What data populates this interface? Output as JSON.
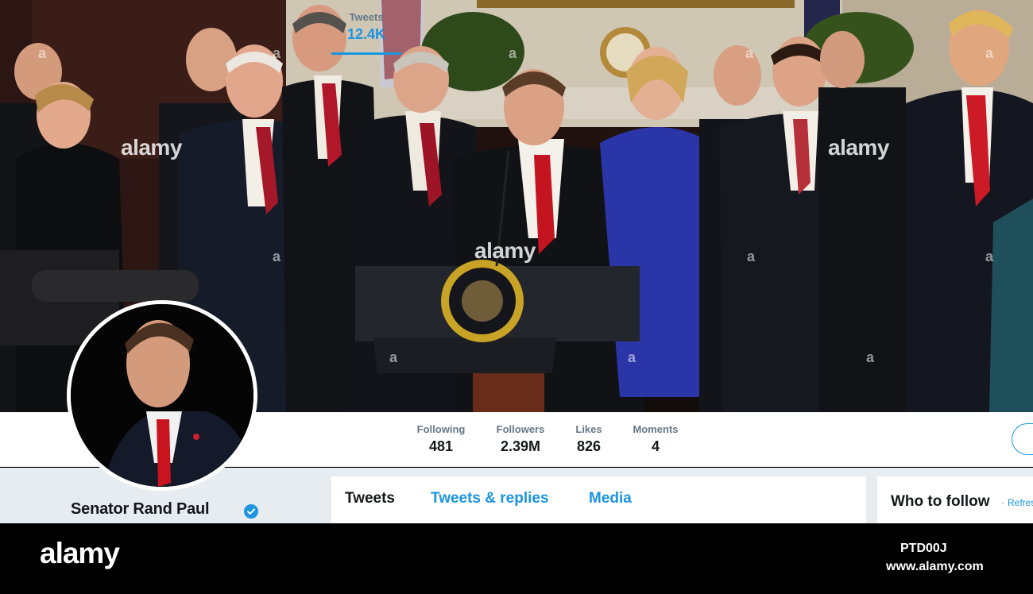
{
  "banner": {
    "watermark_text": "alamy",
    "watermark_small": "a"
  },
  "profile": {
    "name": "Senator Rand Paul",
    "verified": true
  },
  "nav_stats": [
    {
      "label": "Tweets",
      "value": "12.4K",
      "active": true
    },
    {
      "label": "Following",
      "value": "481",
      "active": false
    },
    {
      "label": "Followers",
      "value": "2.39M",
      "active": false
    },
    {
      "label": "Likes",
      "value": "826",
      "active": false
    },
    {
      "label": "Moments",
      "value": "4",
      "active": false
    }
  ],
  "timeline_tabs": {
    "tweets": "Tweets",
    "tweets_replies": "Tweets & replies",
    "media": "Media"
  },
  "who_to_follow": {
    "title": "Who to follow",
    "separator": "·",
    "refresh": "Refresh"
  },
  "footer": {
    "logo": "alamy",
    "image_id": "PTD00J",
    "url": "www.alamy.com"
  },
  "colors": {
    "accent": "#1b95e0",
    "text_dark": "#14171a",
    "text_gray": "#657786",
    "background": "#e6ecf0"
  }
}
